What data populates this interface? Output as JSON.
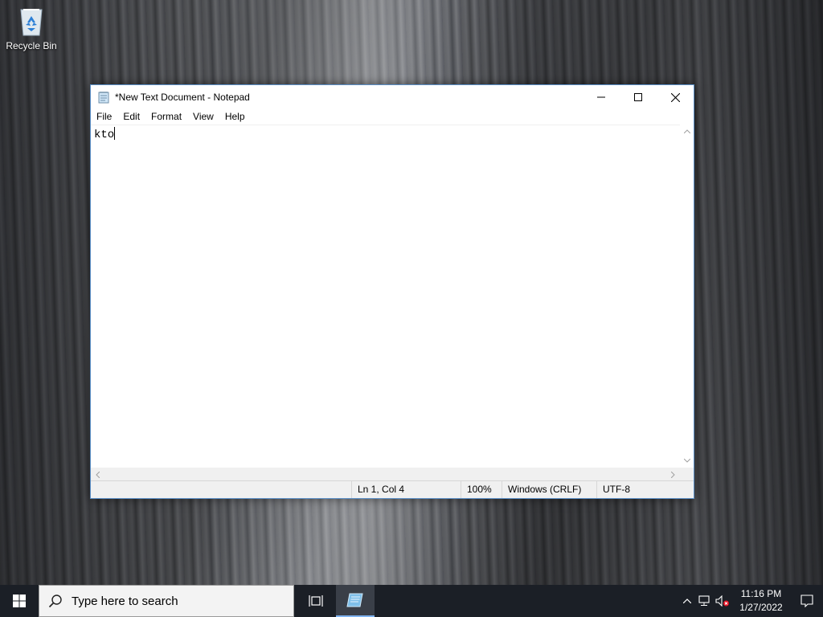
{
  "desktop": {
    "icons": [
      {
        "label": "Recycle Bin",
        "icon": "recycle-bin-icon"
      }
    ]
  },
  "window": {
    "title": "*New Text Document - Notepad",
    "app_icon": "notepad-icon",
    "controls": {
      "minimize": "minimize-icon",
      "maximize": "maximize-icon",
      "close": "close-icon"
    },
    "menu": [
      "File",
      "Edit",
      "Format",
      "View",
      "Help"
    ],
    "content": "kto",
    "status": {
      "position": "Ln 1, Col 4",
      "zoom": "100%",
      "line_endings": "Windows (CRLF)",
      "encoding": "UTF-8"
    }
  },
  "taskbar": {
    "search_placeholder": "Type here to search",
    "clock": {
      "time": "11:16 PM",
      "date": "1/27/2022"
    },
    "tray_icons": [
      "chevron-up-icon",
      "network-icon",
      "volume-muted-icon"
    ]
  }
}
